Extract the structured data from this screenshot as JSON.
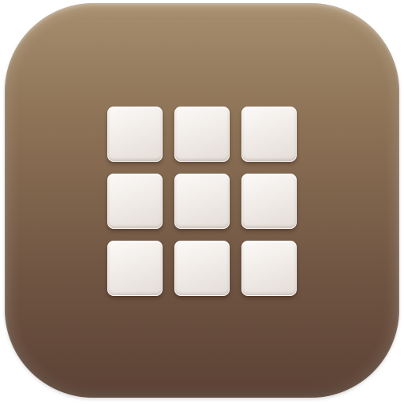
{
  "app_icon": {
    "icon_name": "grid-3x3-icon",
    "tiles": [
      {
        "id": 1
      },
      {
        "id": 2
      },
      {
        "id": 3
      },
      {
        "id": 4
      },
      {
        "id": 5
      },
      {
        "id": 6
      },
      {
        "id": 7
      },
      {
        "id": 8
      },
      {
        "id": 9
      }
    ],
    "colors": {
      "background_top": "#a68e6e",
      "background_bottom": "#5c4235",
      "tile": "#f3f0ed"
    }
  }
}
